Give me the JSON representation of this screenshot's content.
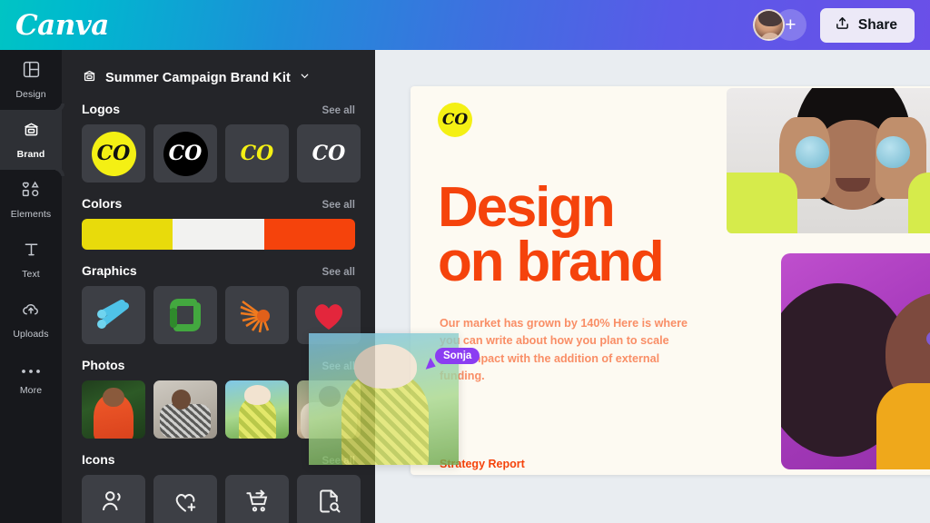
{
  "app": {
    "logo_text": "Canva"
  },
  "topbar": {
    "avatar_name": "user-avatar",
    "add_label": "+",
    "share_label": "Share",
    "share_icon": "upload-icon",
    "gradient_start": "#00c4c4",
    "gradient_end": "#6a4fe8"
  },
  "sidebar": {
    "items": [
      {
        "label": "Design",
        "icon": "layout-icon",
        "active": false
      },
      {
        "label": "Brand",
        "icon": "brand-kit-icon",
        "active": true
      },
      {
        "label": "Elements",
        "icon": "shapes-icon",
        "active": false
      },
      {
        "label": "Text",
        "icon": "text-icon",
        "active": false
      },
      {
        "label": "Uploads",
        "icon": "upload-cloud-icon",
        "active": false
      },
      {
        "label": "More",
        "icon": "ellipsis-icon",
        "active": false
      }
    ]
  },
  "panel": {
    "kit_title": "Summer Campaign Brand Kit",
    "kit_icon": "brand-kit-icon",
    "chevron": "chevron-down-icon",
    "see_all": "See all",
    "sections": {
      "logos": {
        "title": "Logos",
        "see_all": "See all",
        "items": [
          {
            "mark": "CO",
            "bg": "#f4f014",
            "fg": "#111111",
            "shape": "circle"
          },
          {
            "mark": "CO",
            "bg": "#000000",
            "fg": "#ffffff",
            "shape": "circle"
          },
          {
            "mark": "CO",
            "bg": "transparent",
            "fg": "#f4f014",
            "shape": "plain"
          },
          {
            "mark": "CO",
            "bg": "transparent",
            "fg": "#ffffff",
            "shape": "plain"
          }
        ]
      },
      "colors": {
        "title": "Colors",
        "see_all": "See all",
        "swatches": [
          "#e8db0b",
          "#f2f2f0",
          "#f5430c"
        ]
      },
      "graphics": {
        "title": "Graphics",
        "see_all": "See all",
        "items": [
          {
            "name": "blue-clips-graphic",
            "color": "#4fc3e8"
          },
          {
            "name": "green-square-graphic",
            "color": "#43a83f"
          },
          {
            "name": "orange-fan-graphic",
            "color": "#f07a1e"
          },
          {
            "name": "red-heart-graphic",
            "color": "#e3263c"
          }
        ]
      },
      "photos": {
        "title": "Photos",
        "see_all": "See all",
        "items": [
          {
            "name": "photo-woman-orange-jacket"
          },
          {
            "name": "photo-person-laptop"
          },
          {
            "name": "photo-woman-visor"
          },
          {
            "name": "photo-group-outdoors"
          }
        ]
      },
      "icons": {
        "title": "Icons",
        "see_all": "See all",
        "items": [
          {
            "name": "users-icon"
          },
          {
            "name": "heart-plus-icon"
          },
          {
            "name": "cart-arrow-icon"
          },
          {
            "name": "document-search-icon"
          }
        ]
      }
    }
  },
  "canvas": {
    "page_bg": "#fdfaf2",
    "logo_mark": "CO",
    "logo_bg": "#f4f014",
    "headline_line1": "Design",
    "headline_line2": "on brand",
    "headline_color": "#f5430c",
    "body_copy": "Our market has grown by 140% Here is where you can write about how you plan to scale your impact with the addition of external funding.",
    "body_color": "#f98e66",
    "footer_text": "Strategy Report",
    "images": [
      {
        "name": "canvas-photo-eggs-over-eyes"
      },
      {
        "name": "canvas-photo-purple-portrait"
      }
    ]
  },
  "collaborator": {
    "name": "Sonja",
    "color": "#8b3df2",
    "dragging_item": "photo-woman-visor"
  }
}
